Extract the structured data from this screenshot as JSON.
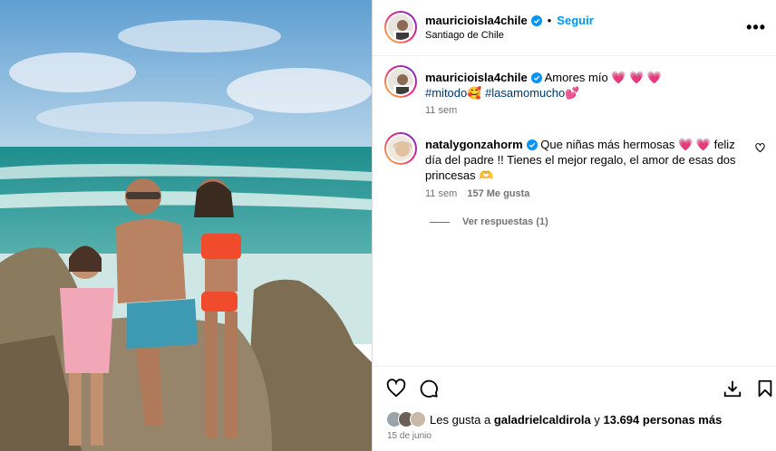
{
  "post": {
    "author": "mauricioisla4chile",
    "separator": "•",
    "follow_label": "Seguir",
    "location": "Santiago de Chile",
    "more_label": "•••"
  },
  "caption": {
    "author": "mauricioisla4chile",
    "text": "Amores mío 💗 💗 💗",
    "hashtag1": "#mitodo",
    "emoji1": "🥰",
    "hashtag2": "#lasamomucho",
    "emoji2": "💕",
    "time": "11 sem"
  },
  "comment": {
    "author": "natalygonzahorm",
    "text": "Que niñas más hermosas 💗 💗  feliz día del padre !! Tienes el mejor regalo, el amor de esas dos princesas 🫶",
    "time": "11 sem",
    "likes": "157 Me gusta",
    "replies": "Ver respuestas (1)"
  },
  "likes": {
    "prefix": "Les gusta a ",
    "user": "galadrielcaldirola",
    "middle": " y ",
    "count": "13.694 personas más"
  },
  "date": "15 de junio",
  "icons": {
    "like": "heart-icon",
    "comment": "comment-icon",
    "save_post": "download-icon",
    "bookmark": "bookmark-icon",
    "verified": "verified-badge-icon",
    "more": "more-options-icon"
  },
  "colors": {
    "accent": "#0095f6",
    "hashtag": "#00376b",
    "muted": "#737373"
  }
}
